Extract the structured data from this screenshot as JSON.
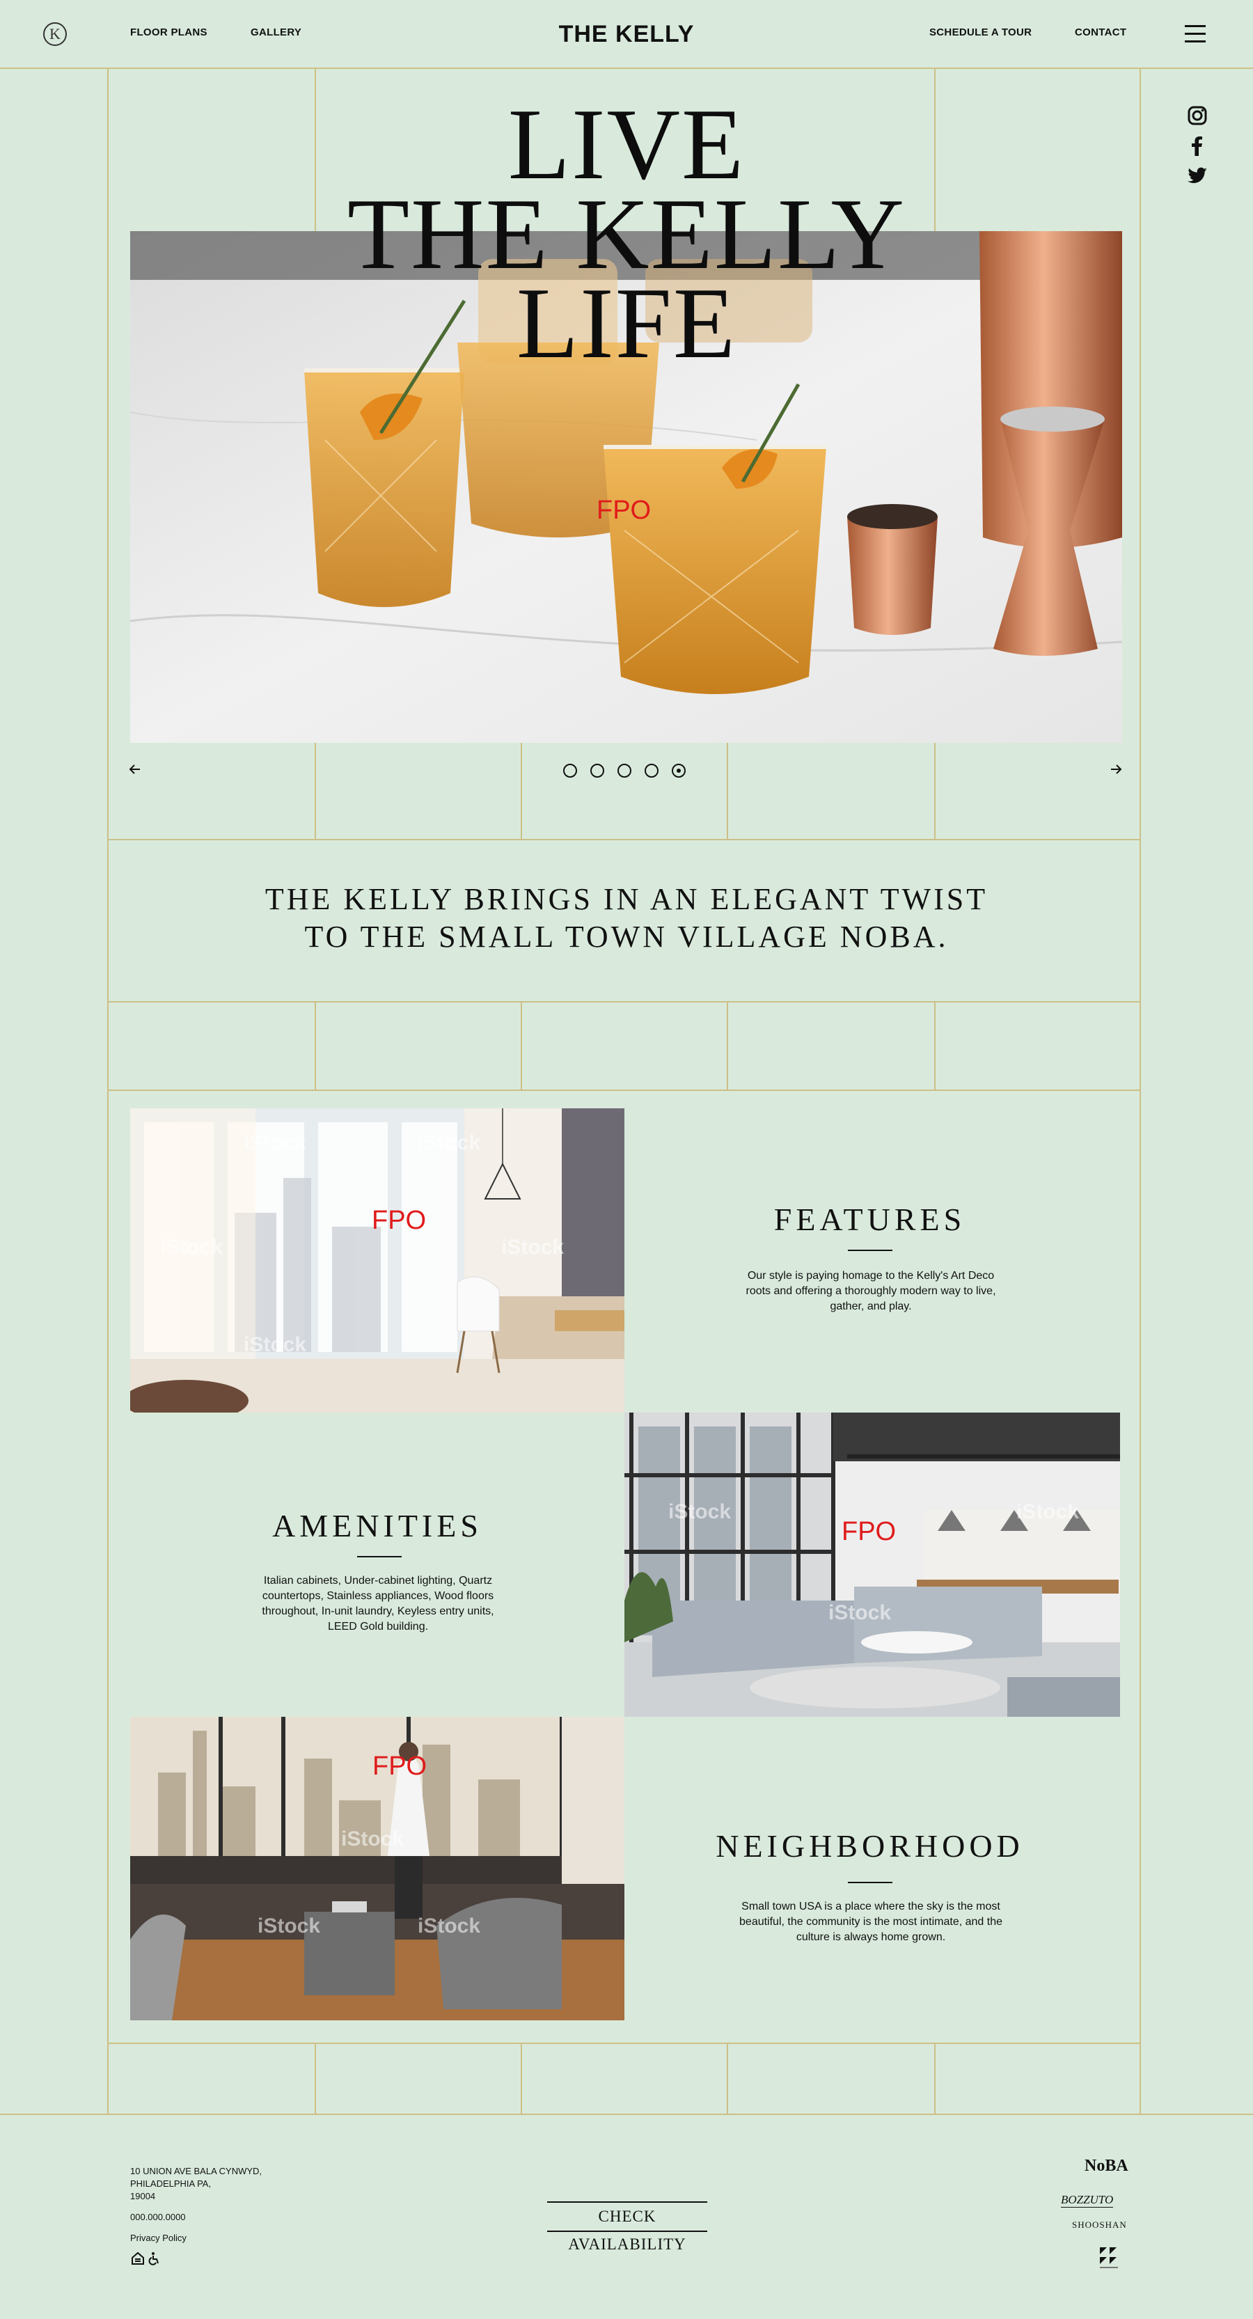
{
  "header": {
    "logo_letter": "K",
    "brand": "THE KELLY",
    "nav_left": [
      "FLOOR PLANS",
      "GALLERY"
    ],
    "nav_right": [
      "SCHEDULE A TOUR",
      "CONTACT"
    ]
  },
  "social": [
    "instagram-icon",
    "facebook-icon",
    "twitter-icon"
  ],
  "hero": {
    "title_lines": [
      "LIVE",
      "THE KELLY",
      "LIFE"
    ],
    "fpo_label": "FPO",
    "slide_count": 5,
    "active_slide": 5
  },
  "tagline": {
    "line1": "THE KELLY BRINGS IN AN ELEGANT TWIST",
    "line2": "TO THE SMALL TOWN VILLAGE NOBA."
  },
  "sections": {
    "features": {
      "title": "FEATURES",
      "text": "Our style is paying homage to the Kelly's Art Deco roots and offering a thoroughly modern way to live, gather, and play."
    },
    "amenities": {
      "title": "AMENITIES",
      "text": "Italian cabinets, Under-cabinet lighting, Quartz countertops, Stainless appliances, Wood floors throughout, In-unit laundry, Keyless entry units, LEED Gold building."
    },
    "neighborhood": {
      "title": "NEIGHBORHOOD",
      "text": "Small town USA is a place where the sky is the most beautiful, the community is the most intimate, and the culture is always home grown."
    }
  },
  "watermark": "iStock",
  "footer": {
    "address_line1": "10 UNION AVE BALA CYNWYD,",
    "address_line2": "PHILADELPHIA PA,",
    "address_line3": "19004",
    "phone": "000.000.0000",
    "privacy": "Privacy Policy",
    "cta": "CHECK AVAILABILITY",
    "partners": [
      "NoBA",
      "BOZZUTO",
      "SHOOSHAN"
    ]
  }
}
